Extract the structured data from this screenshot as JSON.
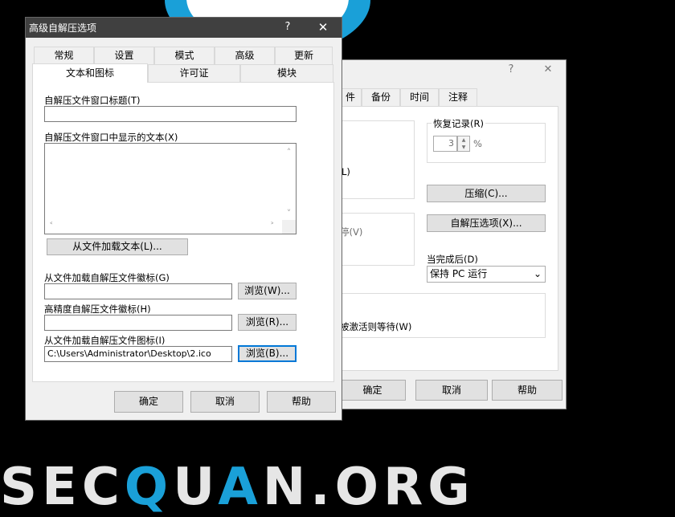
{
  "background": {
    "watermark_parts": [
      "SEC",
      "Q",
      "U",
      "A",
      "N.ORG"
    ],
    "dash_glyph": "▔▔"
  },
  "back_dialog": {
    "help_glyph": "?",
    "close_glyph": "✕",
    "tabs": [
      "件",
      "备份",
      "时间",
      "注释"
    ],
    "recovery_label": "恢复记录(R)",
    "recovery_value": "3",
    "recovery_unit": "%",
    "partial_label_l": "L)",
    "compress_button": "压缩(C)...",
    "sfx_options_button": "自解压选项(X)...",
    "partial_label_pause": "停(V)",
    "on_complete_label": "当完成后(D)",
    "on_complete_value": "保持 PC 运行",
    "partial_label_wait": "被激活则等待(W)",
    "ok_button": "确定",
    "cancel_button": "取消",
    "help_button": "帮助"
  },
  "front_dialog": {
    "title": "高级自解压选项",
    "help_glyph": "?",
    "close_glyph": "✕",
    "tabs_row1": [
      "常规",
      "设置",
      "模式",
      "高级",
      "更新"
    ],
    "tabs_row2": [
      "文本和图标",
      "许可证",
      "模块"
    ],
    "window_title_label": "自解压文件窗口标题(T)",
    "window_title_value": "",
    "display_text_label": "自解压文件窗口中显示的文本(X)",
    "load_text_button": "从文件加载文本(L)...",
    "logo_label": "从文件加载自解压文件徽标(G)",
    "logo_value": "",
    "browse_w_button": "浏览(W)...",
    "hidpi_logo_label": "高精度自解压文件徽标(H)",
    "hidpi_logo_value": "",
    "browse_r_button": "浏览(R)...",
    "icon_label": "从文件加载自解压文件图标(I)",
    "icon_value": "C:\\Users\\Administrator\\Desktop\\2.ico",
    "browse_b_button": "浏览(B)...",
    "ok_button": "确定",
    "cancel_button": "取消",
    "help_button": "帮助"
  },
  "icons": {
    "scroll_up": "˄",
    "scroll_down": "˅",
    "scroll_left": "˂",
    "scroll_right": "˃",
    "spin_up": "▲",
    "spin_down": "▼",
    "dropdown": "⌄"
  }
}
